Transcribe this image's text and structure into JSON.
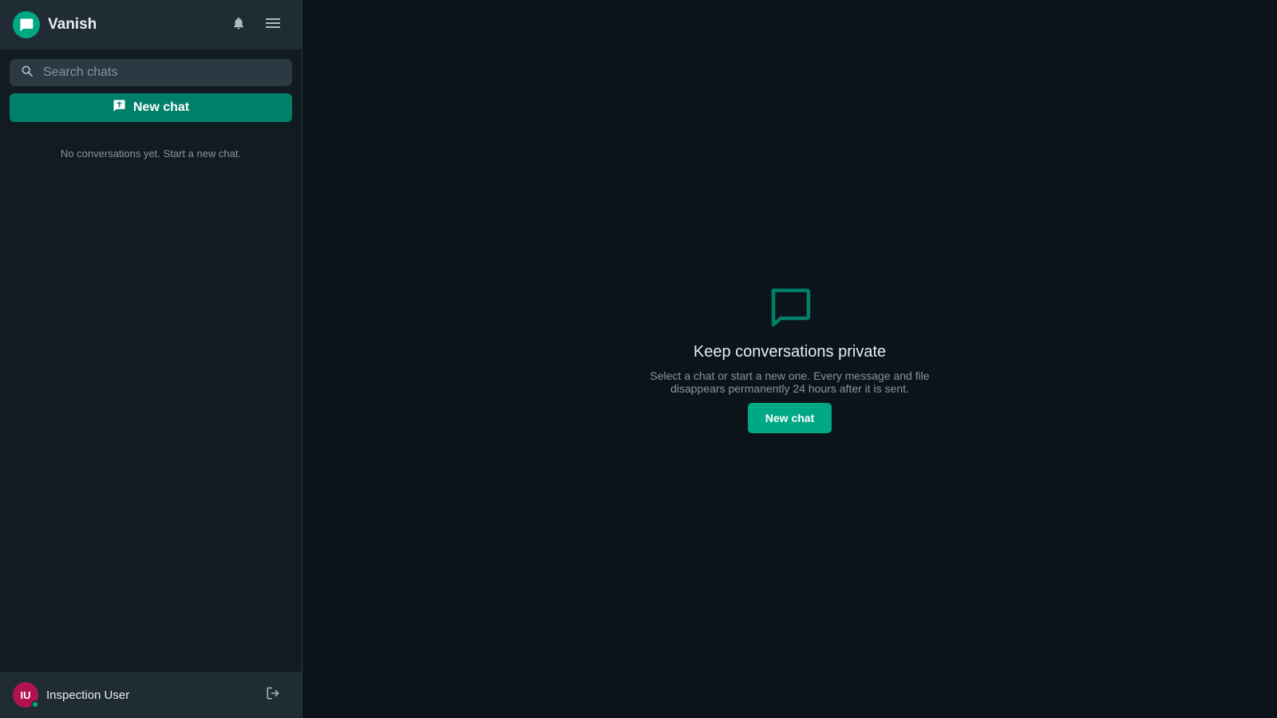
{
  "app": {
    "title": "Vanish"
  },
  "header": {
    "icons": [
      "chat-logo-icon",
      "bell-icon",
      "menu-icon"
    ]
  },
  "search": {
    "placeholder": "Search chats",
    "value": ""
  },
  "sidebar": {
    "new_chat_label": "New chat",
    "empty_text": "No conversations yet. Start a new chat."
  },
  "user": {
    "initials": "IU",
    "name": "Inspection User",
    "status": "online"
  },
  "welcome": {
    "title": "Keep conversations private",
    "subtitle": "Select a chat or start a new one. Every message and file disappears permanently 24 hours after it is sent.",
    "button_label": "New chat"
  },
  "colors": {
    "accent": "#00a884",
    "accent_dark": "#008069",
    "avatar": "#b0134f",
    "background": "#0b141a",
    "sidebar": "#111b21",
    "panel": "#1f2c34"
  }
}
